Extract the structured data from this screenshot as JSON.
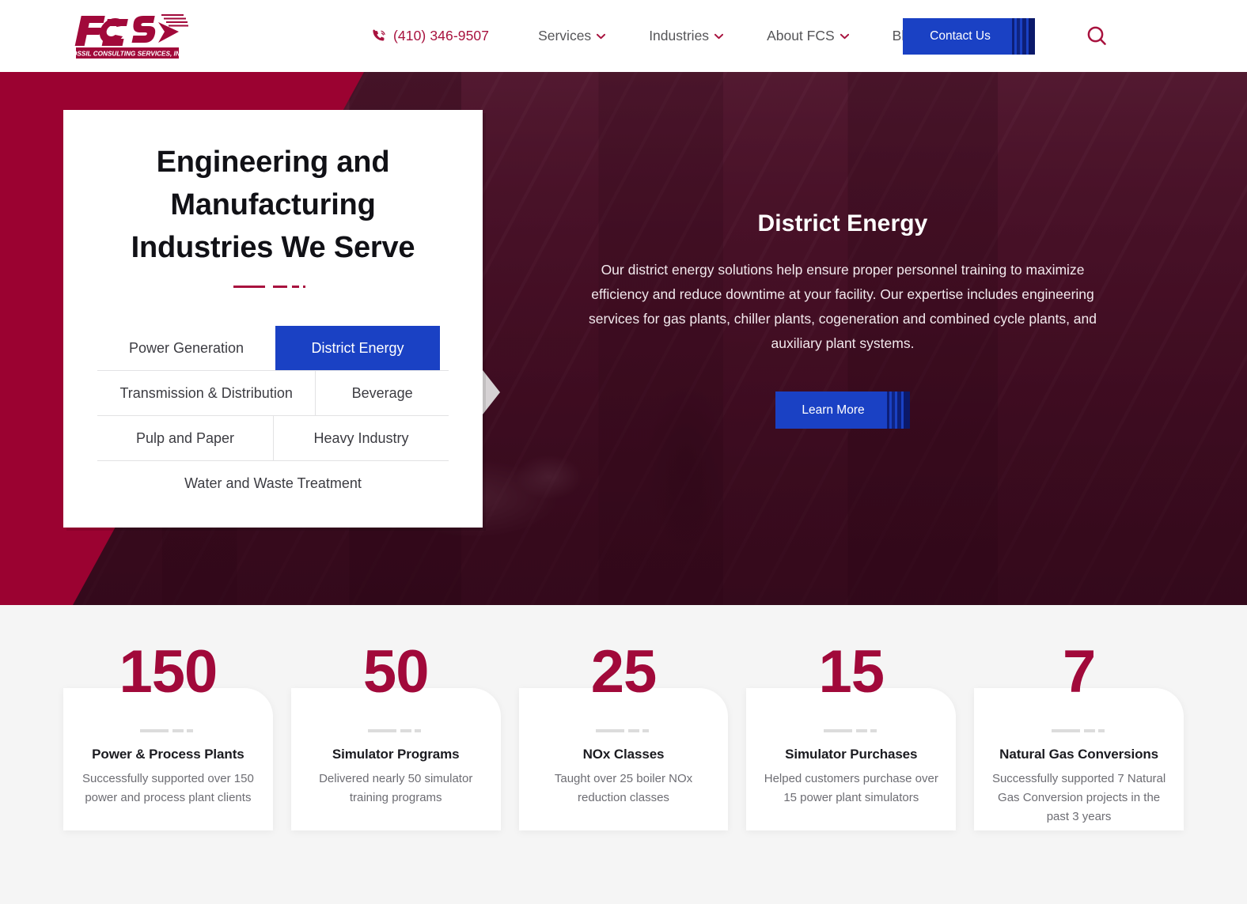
{
  "header": {
    "logo": {
      "mark": "FCS",
      "tagline": "FOSSIL CONSULTING SERVICES, INC."
    },
    "phone": "(410) 346-9507",
    "phone_icon": "phone-call-icon",
    "nav": [
      {
        "label": "Services",
        "has_caret": true
      },
      {
        "label": "Industries",
        "has_caret": true
      },
      {
        "label": "About FCS",
        "has_caret": true
      },
      {
        "label": "Blog",
        "has_caret": false
      }
    ],
    "contact_label": "Contact Us",
    "search_icon": "search-icon"
  },
  "hero": {
    "title": "Engineering and Manufacturing Industries We Serve",
    "tabs": [
      {
        "label": "Power Generation",
        "active": false
      },
      {
        "label": "District Energy",
        "active": true
      },
      {
        "label": "Transmission & Distribution",
        "active": false
      },
      {
        "label": "Beverage",
        "active": false
      },
      {
        "label": "Pulp and Paper",
        "active": false
      },
      {
        "label": "Heavy Industry",
        "active": false
      },
      {
        "label": "Water and Waste Treatment",
        "active": false
      }
    ],
    "panel": {
      "heading": "District Energy",
      "body": "Our district energy solutions help ensure proper personnel training to maximize efficiency and reduce downtime at your facility. Our expertise includes engineering services for gas plants, chiller plants, cogeneration and combined cycle plants, and auxiliary plant systems.",
      "cta_label": "Learn More"
    }
  },
  "stats": [
    {
      "number": "150",
      "title": "Power & Process Plants",
      "description": "Successfully supported over 150 power and process plant clients"
    },
    {
      "number": "50",
      "title": "Simulator Programs",
      "description": "Delivered nearly 50 simulator training programs"
    },
    {
      "number": "25",
      "title": "NOx Classes",
      "description": "Taught over 25 boiler NOx reduction classes"
    },
    {
      "number": "15",
      "title": "Simulator Purchases",
      "description": "Helped customers purchase over 15 power plant simulators"
    },
    {
      "number": "7",
      "title": "Natural Gas Conversions",
      "description": "Successfully supported 7 Natural Gas Conversion projects in the past 3 years"
    }
  ],
  "colors": {
    "crimson": "#9B0231",
    "brand_red": "#A8123E",
    "blue": "#1A41C4",
    "stat_number": "#A1093A",
    "stats_bg": "#f5f5f5"
  }
}
